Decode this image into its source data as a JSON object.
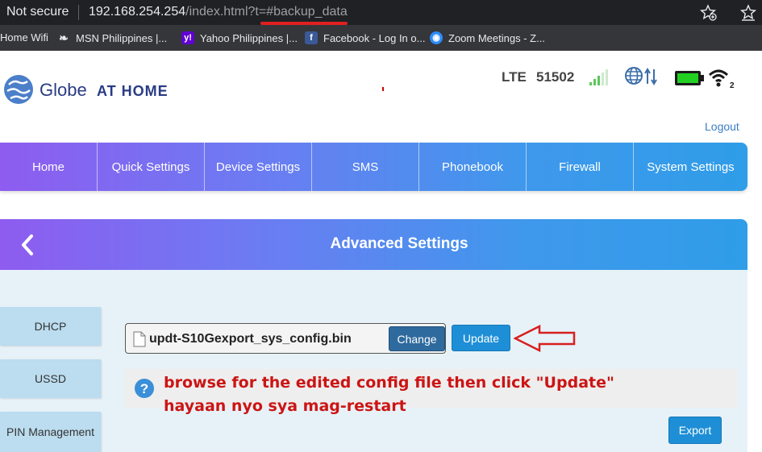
{
  "browser": {
    "security_label": "Not secure",
    "url_host": "192.168.254.254",
    "url_path": "/index.html?t=",
    "url_hash": "#backup_data",
    "bookmarks": [
      {
        "label": "Home Wifi",
        "icon": "none"
      },
      {
        "label": "MSN Philippines |...",
        "icon": "msn-icon"
      },
      {
        "label": "Yahoo Philippines |...",
        "icon": "yahoo-icon"
      },
      {
        "label": "Facebook - Log In o...",
        "icon": "facebook-icon"
      },
      {
        "label": "Zoom Meetings - Z...",
        "icon": "zoom-icon"
      }
    ]
  },
  "header": {
    "brand_globe": "Globe",
    "brand_athome": "AT HOME",
    "network_type": "LTE",
    "network_code": "51502",
    "wifi_clients": "2",
    "logout_label": "Logout"
  },
  "nav": {
    "items": [
      "Home",
      "Quick Settings",
      "Device Settings",
      "SMS",
      "Phonebook",
      "Firewall",
      "System Settings"
    ]
  },
  "advanced": {
    "title": "Advanced Settings",
    "side_items": [
      "DHCP",
      "USSD",
      "PIN Management"
    ],
    "file_name": "updt-S10Gexport_sys_config.bin",
    "change_label": "Change",
    "update_label": "Update",
    "export_label": "Export"
  },
  "annotation": {
    "line1": "browse for the edited config file then click \"Update\"",
    "line2": "hayaan nyo sya mag-restart"
  },
  "colors": {
    "accent": "#1e8fd6",
    "annotation_red": "#cc1414",
    "brand_blue": "#2a3b84"
  }
}
